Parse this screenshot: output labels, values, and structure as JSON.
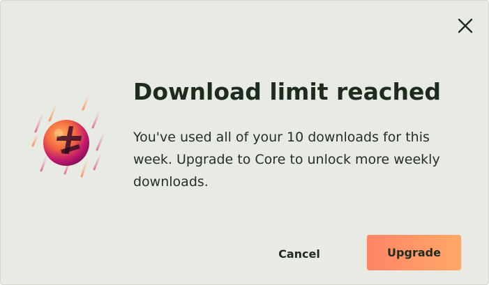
{
  "dialog": {
    "title": "Download limit reached",
    "message": "You've used all of your 10 downloads for this week. Upgrade to Core to unlock more weekly downloads.",
    "close_icon": "close-icon",
    "illustration_icon": "download-limit-orb-icon"
  },
  "actions": {
    "cancel_label": "Cancel",
    "upgrade_label": "Upgrade"
  },
  "colors": {
    "background": "#e8ebe4",
    "text": "#1e2b1f",
    "upgrade_gradient_start": "#ff8565",
    "upgrade_gradient_end": "#ffa868",
    "orb_magenta": "#c0186d",
    "orb_orange": "#ff9a3d"
  }
}
